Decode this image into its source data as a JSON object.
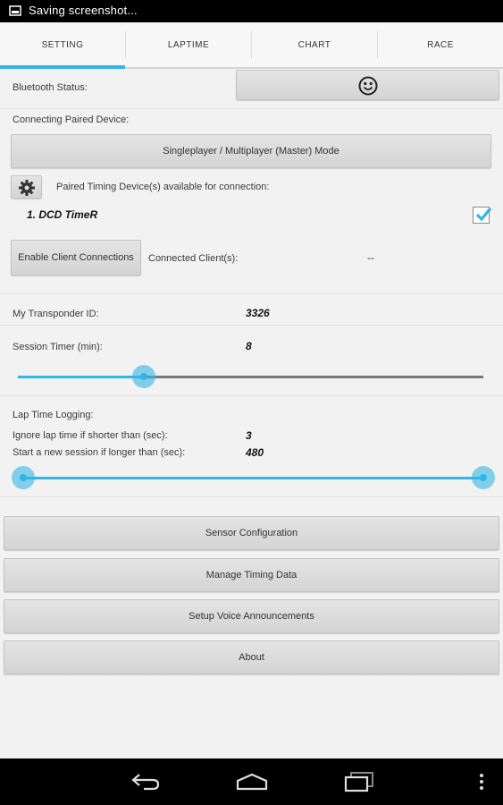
{
  "status_bar": {
    "text": "Saving screenshot..."
  },
  "tabs": [
    {
      "label": "SETTING",
      "active": true
    },
    {
      "label": "LAPTIME",
      "active": false
    },
    {
      "label": "CHART",
      "active": false
    },
    {
      "label": "RACE",
      "active": false
    }
  ],
  "bluetooth": {
    "label": "Bluetooth Status:",
    "status_icon": "smiley-icon"
  },
  "connecting": {
    "label": "Connecting Paired Device:",
    "mode_button": "Singleplayer / Multiplayer (Master) Mode",
    "settings_icon": "gear-icon",
    "paired_label": "Paired Timing Device(s) available for connection:",
    "device_name": "1. DCD TimeR",
    "device_checked": true,
    "enable_button": "Enable Client Connections",
    "clients_label": "Connected Client(s):",
    "clients_value": "--"
  },
  "transponder": {
    "label": "My Transponder ID:",
    "value": "3326"
  },
  "session_timer": {
    "label": "Session Timer (min):",
    "value": "8",
    "slider_fraction": 0.27
  },
  "lap_logging": {
    "label": "Lap Time Logging:",
    "ignore_label": "Ignore lap time if shorter than (sec):",
    "ignore_value": "3",
    "new_session_label": "Start a new session if longer than (sec):",
    "new_session_value": "480",
    "range_low_fraction": 0.0,
    "range_high_fraction": 1.0
  },
  "menu": [
    {
      "label": "Sensor Configuration"
    },
    {
      "label": "Manage Timing Data"
    },
    {
      "label": "Setup Voice Announcements"
    },
    {
      "label": "About"
    }
  ],
  "colors": {
    "accent": "#33b5e5",
    "track_inactive": "#7a7a7a"
  }
}
